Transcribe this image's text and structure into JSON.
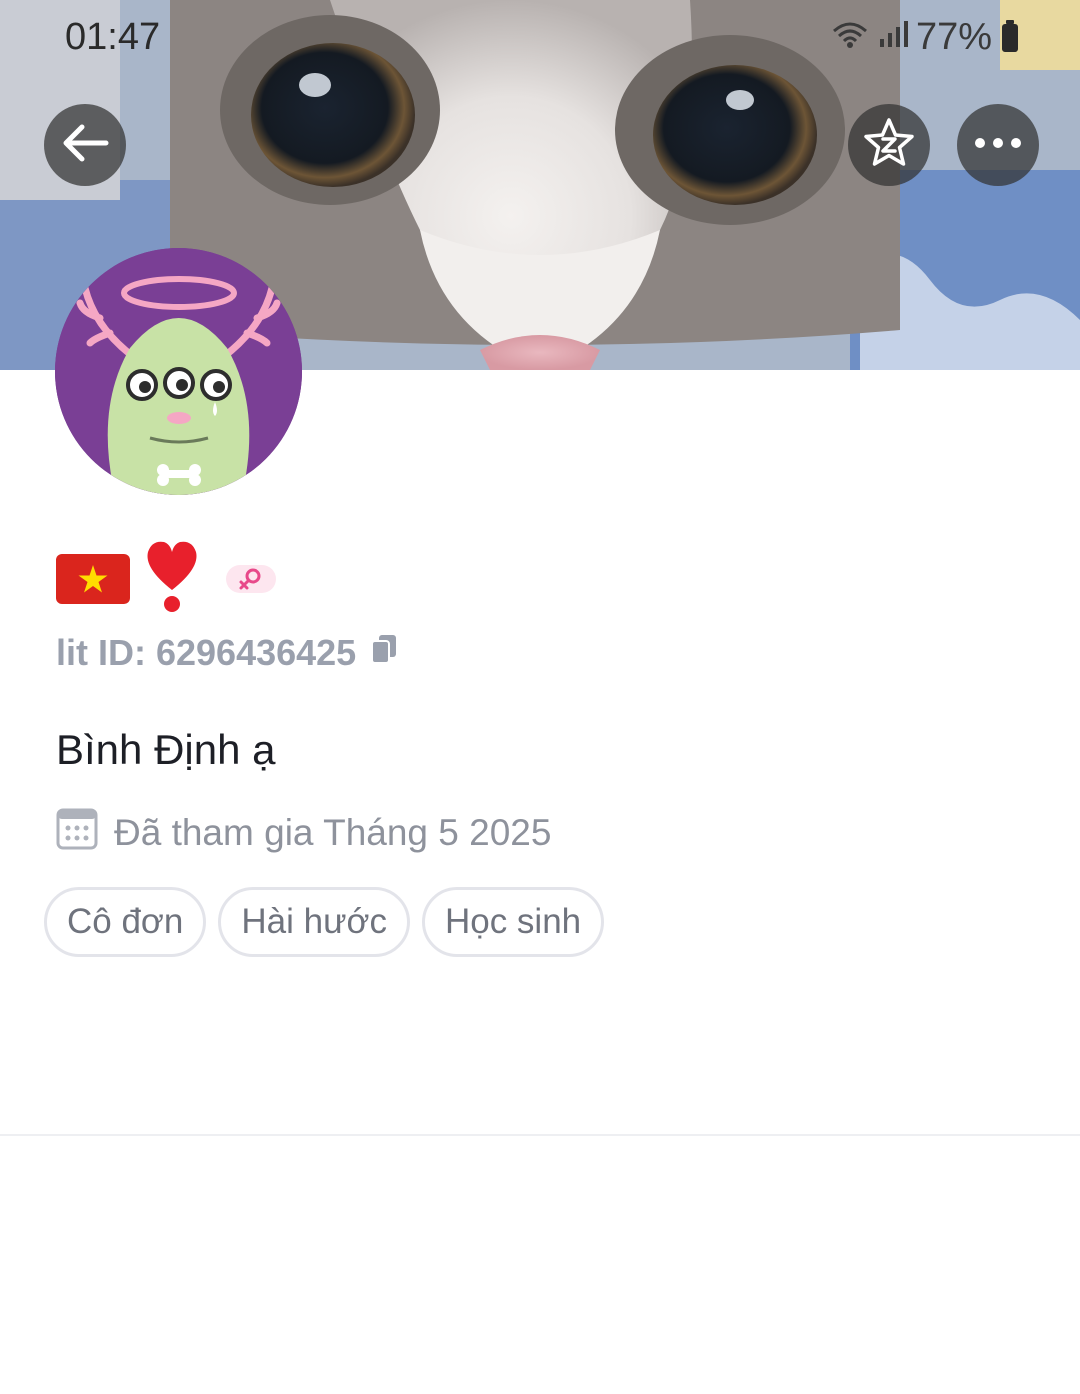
{
  "status_bar": {
    "time": "01:47",
    "battery": "77%"
  },
  "header": {
    "icons": [
      "back-arrow-icon",
      "z-star-icon",
      "more-dots-icon"
    ]
  },
  "profile": {
    "badges": [
      "vietnam-flag-icon",
      "heart-exclamation-icon",
      "female-gender-icon"
    ],
    "lit_id_label": "lit ID: 6296436425",
    "bio": "Bình Định ạ",
    "joined": "Đã tham gia Tháng 5 2025",
    "tags": [
      "Cô đơn",
      "Hài hước",
      "Học sinh"
    ]
  },
  "colors": {
    "avatar_bg": "#7a3f95",
    "monster_green": "#c8e2a6",
    "muted_text": "#9aa0ad",
    "tag_border": "#e3e4ea"
  }
}
